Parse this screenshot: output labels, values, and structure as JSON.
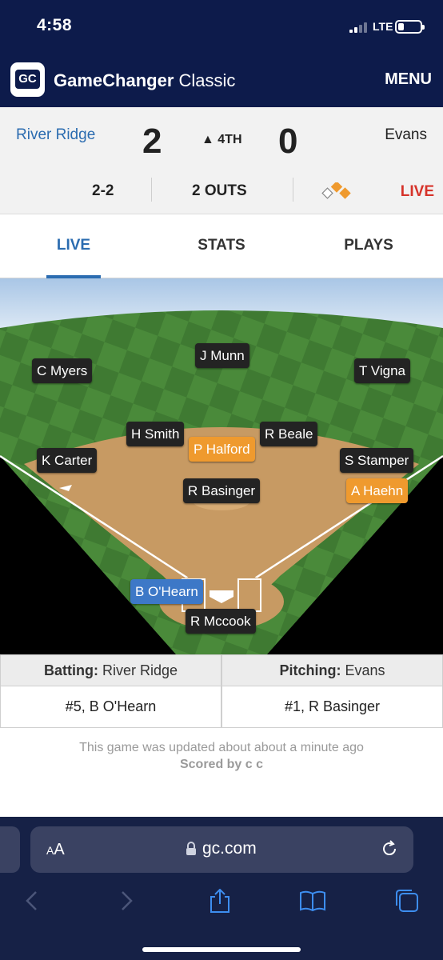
{
  "status_bar": {
    "time": "4:58",
    "network": "LTE",
    "battery_level": 0.28
  },
  "header": {
    "logo_text": "GC",
    "brand_bold": "GameChanger",
    "brand_rest": "Classic",
    "menu_label": "MENU"
  },
  "scoreboard": {
    "away_team": "River Ridge",
    "away_score": "2",
    "inning": "▲ 4TH",
    "home_score": "0",
    "home_team": "Evans",
    "count": "2-2",
    "outs": "2 OUTS",
    "live_label": "LIVE",
    "runners": {
      "first": true,
      "second": true,
      "third": false
    }
  },
  "tabs": [
    {
      "label": "LIVE",
      "active": true
    },
    {
      "label": "STATS",
      "active": false
    },
    {
      "label": "PLAYS",
      "active": false
    }
  ],
  "field": {
    "players": [
      {
        "name": "J Munn",
        "role": "fielder"
      },
      {
        "name": "C Myers",
        "role": "fielder"
      },
      {
        "name": "T Vigna",
        "role": "fielder"
      },
      {
        "name": "H Smith",
        "role": "fielder"
      },
      {
        "name": "R Beale",
        "role": "fielder"
      },
      {
        "name": "P Halford",
        "role": "runner"
      },
      {
        "name": "K Carter",
        "role": "fielder"
      },
      {
        "name": "S Stamper",
        "role": "fielder"
      },
      {
        "name": "R Basinger",
        "role": "pitcher"
      },
      {
        "name": "A Haehn",
        "role": "runner"
      },
      {
        "name": "B O'Hearn",
        "role": "batter"
      },
      {
        "name": "R Mccook",
        "role": "catcher"
      }
    ]
  },
  "matchup": {
    "batting_label": "Batting:",
    "batting_team": "River Ridge",
    "pitching_label": "Pitching:",
    "pitching_team": "Evans",
    "batter": "#5, B O'Hearn",
    "pitcher": "#1, R Basinger"
  },
  "footer": {
    "updated_text": "This game was updated about about a minute ago",
    "scored_by": "Scored by c c"
  },
  "browser": {
    "aa_small": "A",
    "aa_large": "A",
    "url": "gc.com"
  },
  "colors": {
    "navy": "#0d1b4b",
    "accent_blue": "#2b6cb0",
    "live_red": "#d6332a",
    "runner_orange": "#ef9a2e",
    "batter_blue": "#3d78c7"
  }
}
